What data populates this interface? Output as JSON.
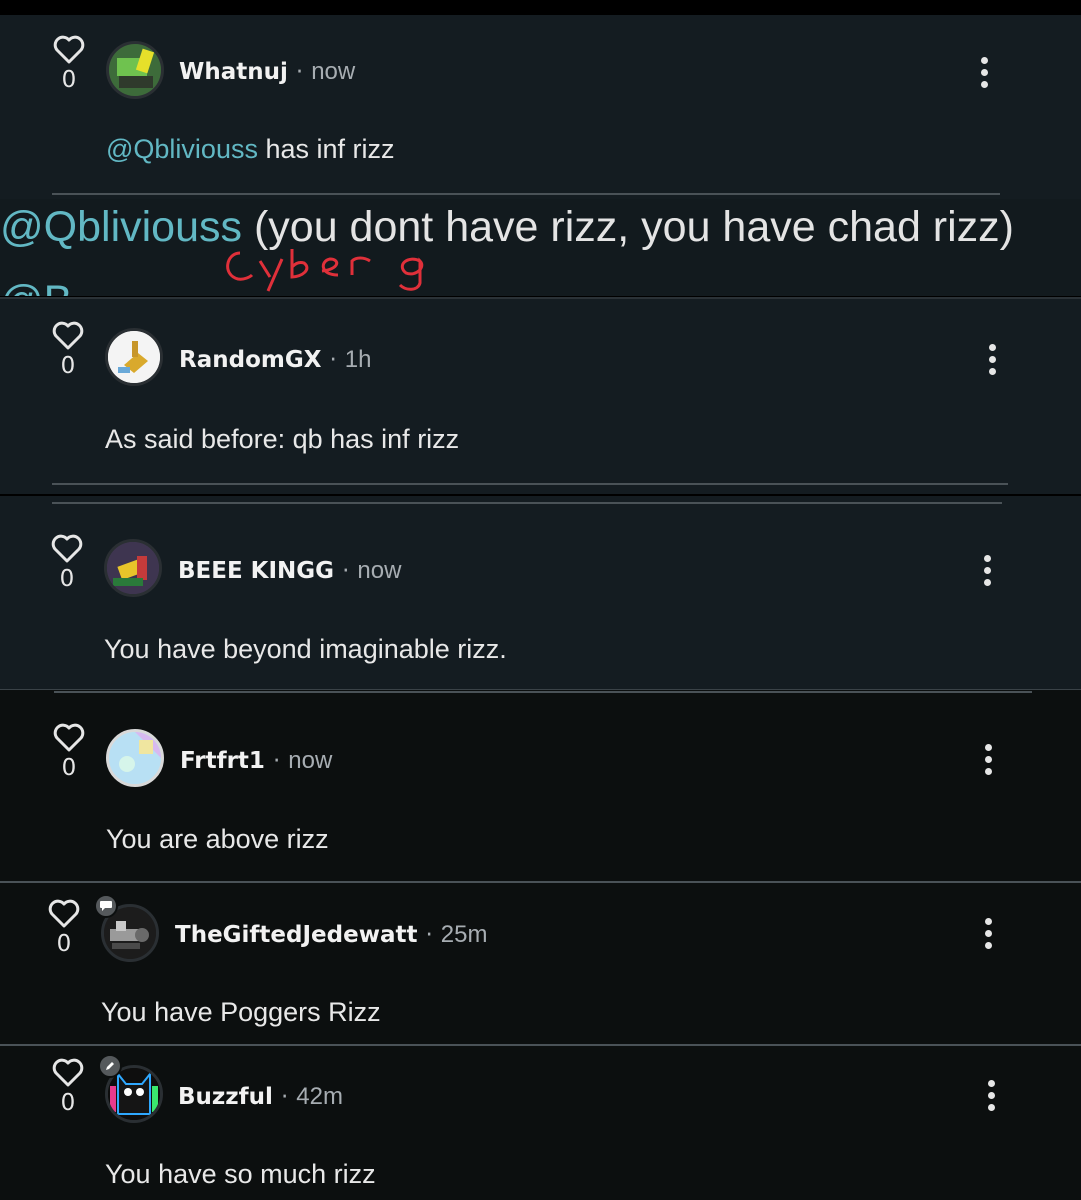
{
  "colors": {
    "mention": "#62b8c4",
    "card_dark": "#141c21",
    "card_black": "#0c0f0f",
    "scribble": "#e0303a"
  },
  "comments": [
    {
      "likes": "0",
      "username": "Whatnuj",
      "time": "now",
      "mention": "@Qbliviouss",
      "text": " has inf rizz",
      "avatar_icon": "green-robot-avatar"
    },
    {
      "likes": "0",
      "username": "RandomGX",
      "time": "1h",
      "text": "As said before: qb has inf rizz",
      "avatar_icon": "gold-block-avatar"
    },
    {
      "likes": "0",
      "username": "BEEE KINGG",
      "time": "now",
      "text": "You have beyond imaginable rizz.",
      "avatar_icon": "bee-avatar"
    },
    {
      "likes": "0",
      "username": "Frtfrt1",
      "time": "now",
      "text": "You are above rizz",
      "avatar_icon": "pastel-avatar"
    },
    {
      "likes": "0",
      "username": "TheGiftedJedewatt",
      "time": "25m",
      "text": "You have Poggers Rizz",
      "avatar_icon": "mech-avatar",
      "badge_icon": "chat-bubble-icon"
    },
    {
      "likes": "0",
      "username": "Buzzful",
      "time": "42m",
      "text": "You have so much rizz",
      "avatar_icon": "cat-avatar",
      "badge_icon": "pencil-icon"
    }
  ],
  "overlay": {
    "mention": "@Qbliviouss",
    "text": " (you dont have rizz, you have chad rizz)",
    "scribble_text": "Cyber"
  },
  "dot": "·"
}
